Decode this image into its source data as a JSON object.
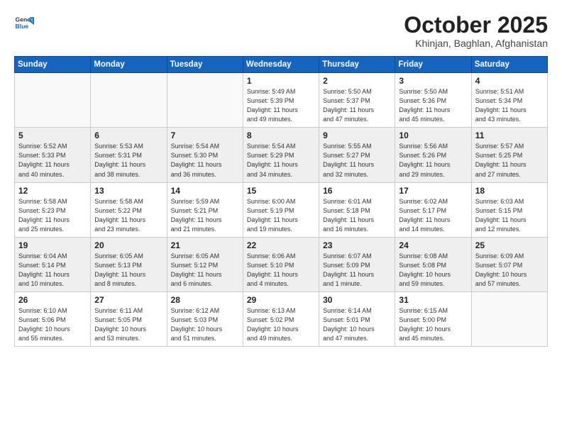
{
  "header": {
    "logo_general": "General",
    "logo_blue": "Blue",
    "month": "October 2025",
    "location": "Khinjan, Baghlan, Afghanistan"
  },
  "days_of_week": [
    "Sunday",
    "Monday",
    "Tuesday",
    "Wednesday",
    "Thursday",
    "Friday",
    "Saturday"
  ],
  "weeks": [
    [
      {
        "day": "",
        "info": ""
      },
      {
        "day": "",
        "info": ""
      },
      {
        "day": "",
        "info": ""
      },
      {
        "day": "1",
        "info": "Sunrise: 5:49 AM\nSunset: 5:39 PM\nDaylight: 11 hours\nand 49 minutes."
      },
      {
        "day": "2",
        "info": "Sunrise: 5:50 AM\nSunset: 5:37 PM\nDaylight: 11 hours\nand 47 minutes."
      },
      {
        "day": "3",
        "info": "Sunrise: 5:50 AM\nSunset: 5:36 PM\nDaylight: 11 hours\nand 45 minutes."
      },
      {
        "day": "4",
        "info": "Sunrise: 5:51 AM\nSunset: 5:34 PM\nDaylight: 11 hours\nand 43 minutes."
      }
    ],
    [
      {
        "day": "5",
        "info": "Sunrise: 5:52 AM\nSunset: 5:33 PM\nDaylight: 11 hours\nand 40 minutes."
      },
      {
        "day": "6",
        "info": "Sunrise: 5:53 AM\nSunset: 5:31 PM\nDaylight: 11 hours\nand 38 minutes."
      },
      {
        "day": "7",
        "info": "Sunrise: 5:54 AM\nSunset: 5:30 PM\nDaylight: 11 hours\nand 36 minutes."
      },
      {
        "day": "8",
        "info": "Sunrise: 5:54 AM\nSunset: 5:29 PM\nDaylight: 11 hours\nand 34 minutes."
      },
      {
        "day": "9",
        "info": "Sunrise: 5:55 AM\nSunset: 5:27 PM\nDaylight: 11 hours\nand 32 minutes."
      },
      {
        "day": "10",
        "info": "Sunrise: 5:56 AM\nSunset: 5:26 PM\nDaylight: 11 hours\nand 29 minutes."
      },
      {
        "day": "11",
        "info": "Sunrise: 5:57 AM\nSunset: 5:25 PM\nDaylight: 11 hours\nand 27 minutes."
      }
    ],
    [
      {
        "day": "12",
        "info": "Sunrise: 5:58 AM\nSunset: 5:23 PM\nDaylight: 11 hours\nand 25 minutes."
      },
      {
        "day": "13",
        "info": "Sunrise: 5:58 AM\nSunset: 5:22 PM\nDaylight: 11 hours\nand 23 minutes."
      },
      {
        "day": "14",
        "info": "Sunrise: 5:59 AM\nSunset: 5:21 PM\nDaylight: 11 hours\nand 21 minutes."
      },
      {
        "day": "15",
        "info": "Sunrise: 6:00 AM\nSunset: 5:19 PM\nDaylight: 11 hours\nand 19 minutes."
      },
      {
        "day": "16",
        "info": "Sunrise: 6:01 AM\nSunset: 5:18 PM\nDaylight: 11 hours\nand 16 minutes."
      },
      {
        "day": "17",
        "info": "Sunrise: 6:02 AM\nSunset: 5:17 PM\nDaylight: 11 hours\nand 14 minutes."
      },
      {
        "day": "18",
        "info": "Sunrise: 6:03 AM\nSunset: 5:15 PM\nDaylight: 11 hours\nand 12 minutes."
      }
    ],
    [
      {
        "day": "19",
        "info": "Sunrise: 6:04 AM\nSunset: 5:14 PM\nDaylight: 11 hours\nand 10 minutes."
      },
      {
        "day": "20",
        "info": "Sunrise: 6:05 AM\nSunset: 5:13 PM\nDaylight: 11 hours\nand 8 minutes."
      },
      {
        "day": "21",
        "info": "Sunrise: 6:05 AM\nSunset: 5:12 PM\nDaylight: 11 hours\nand 6 minutes."
      },
      {
        "day": "22",
        "info": "Sunrise: 6:06 AM\nSunset: 5:10 PM\nDaylight: 11 hours\nand 4 minutes."
      },
      {
        "day": "23",
        "info": "Sunrise: 6:07 AM\nSunset: 5:09 PM\nDaylight: 11 hours\nand 1 minute."
      },
      {
        "day": "24",
        "info": "Sunrise: 6:08 AM\nSunset: 5:08 PM\nDaylight: 10 hours\nand 59 minutes."
      },
      {
        "day": "25",
        "info": "Sunrise: 6:09 AM\nSunset: 5:07 PM\nDaylight: 10 hours\nand 57 minutes."
      }
    ],
    [
      {
        "day": "26",
        "info": "Sunrise: 6:10 AM\nSunset: 5:06 PM\nDaylight: 10 hours\nand 55 minutes."
      },
      {
        "day": "27",
        "info": "Sunrise: 6:11 AM\nSunset: 5:05 PM\nDaylight: 10 hours\nand 53 minutes."
      },
      {
        "day": "28",
        "info": "Sunrise: 6:12 AM\nSunset: 5:03 PM\nDaylight: 10 hours\nand 51 minutes."
      },
      {
        "day": "29",
        "info": "Sunrise: 6:13 AM\nSunset: 5:02 PM\nDaylight: 10 hours\nand 49 minutes."
      },
      {
        "day": "30",
        "info": "Sunrise: 6:14 AM\nSunset: 5:01 PM\nDaylight: 10 hours\nand 47 minutes."
      },
      {
        "day": "31",
        "info": "Sunrise: 6:15 AM\nSunset: 5:00 PM\nDaylight: 10 hours\nand 45 minutes."
      },
      {
        "day": "",
        "info": ""
      }
    ]
  ]
}
